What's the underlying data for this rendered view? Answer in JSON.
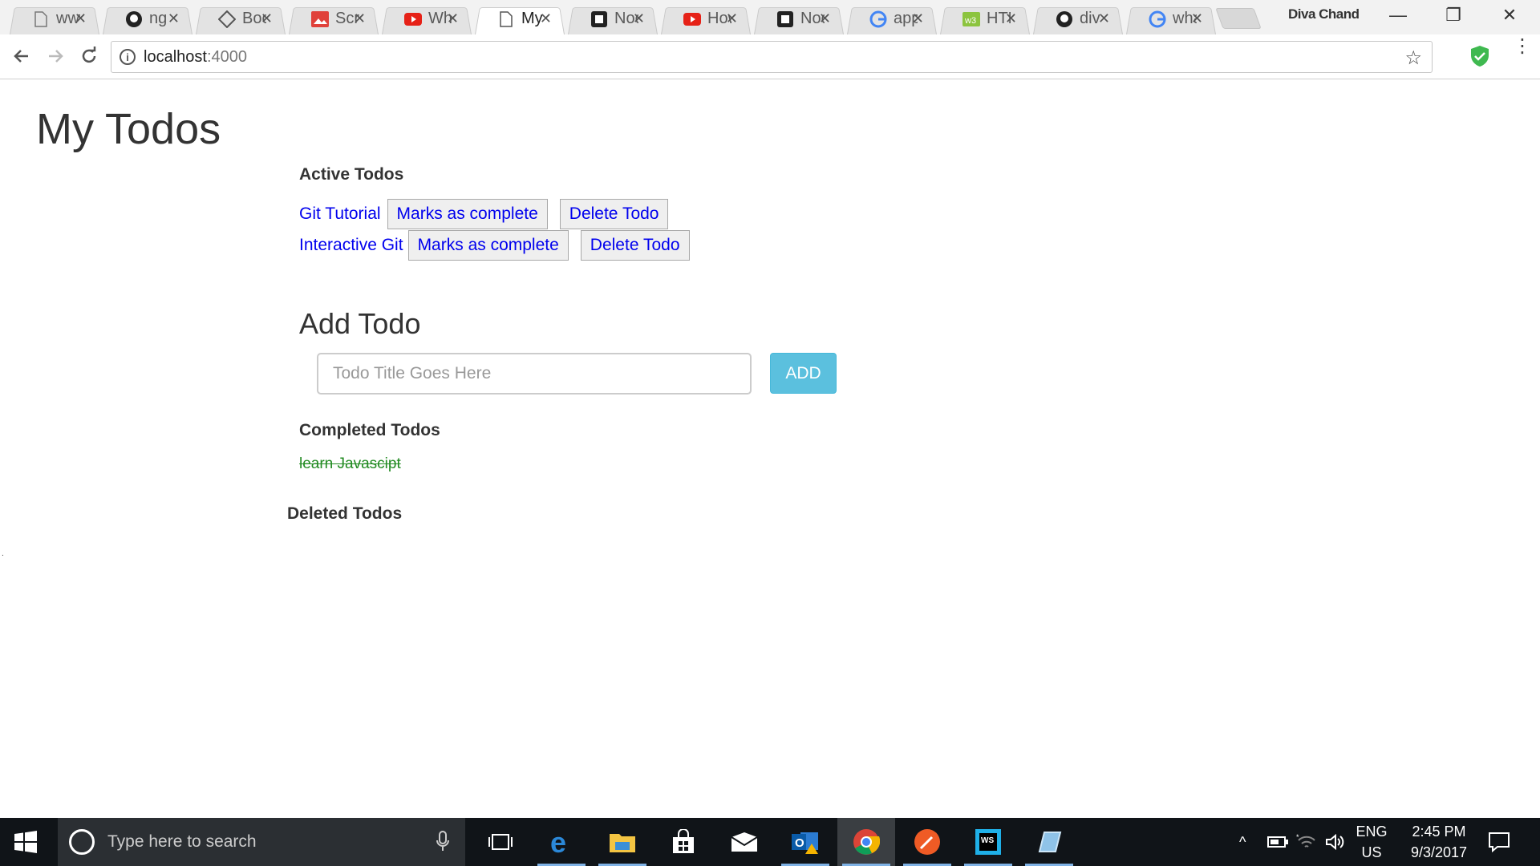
{
  "browser": {
    "tabs": [
      {
        "title": "www",
        "icon": "document-icon"
      },
      {
        "title": "ng",
        "icon": "github-icon"
      },
      {
        "title": "Bootstrap",
        "icon": "diamond-icon"
      },
      {
        "title": "Screenshot",
        "icon": "image-icon"
      },
      {
        "title": "What",
        "icon": "youtube-icon"
      },
      {
        "title": "My Todos",
        "icon": "document-icon",
        "active": true
      },
      {
        "title": "Node",
        "icon": "notion-icon"
      },
      {
        "title": "How",
        "icon": "youtube-icon"
      },
      {
        "title": "Node",
        "icon": "notion-icon"
      },
      {
        "title": "app",
        "icon": "google-icon"
      },
      {
        "title": "HTML",
        "icon": "w3-icon"
      },
      {
        "title": "div",
        "icon": "github-icon"
      },
      {
        "title": "what",
        "icon": "google-icon"
      }
    ],
    "profile_name": "Diva Chand",
    "url_host": "localhost",
    "url_port": ":4000"
  },
  "page": {
    "title": "My Todos",
    "active_heading": "Active Todos",
    "active_todos": [
      {
        "title": "Git Tutorial",
        "complete_label": "Marks as complete",
        "delete_label": "Delete Todo"
      },
      {
        "title": "Interactive Git",
        "complete_label": "Marks as complete",
        "delete_label": "Delete Todo"
      }
    ],
    "add_heading": "Add Todo",
    "input_placeholder": "Todo Title Goes Here",
    "input_value": "",
    "add_button": "ADD",
    "completed_heading": "Completed Todos",
    "completed_todos": [
      "learn Javascipt"
    ],
    "deleted_heading": "Deleted Todos",
    "stray_text": "."
  },
  "taskbar": {
    "search_placeholder": "Type here to search",
    "language_line1": "ENG",
    "language_line2": "US",
    "time": "2:45 PM",
    "date": "9/3/2017"
  },
  "colors": {
    "link": "#0000ee",
    "completed": "#228b22",
    "add_button": "#5bc0de",
    "taskbar": "#101418"
  }
}
